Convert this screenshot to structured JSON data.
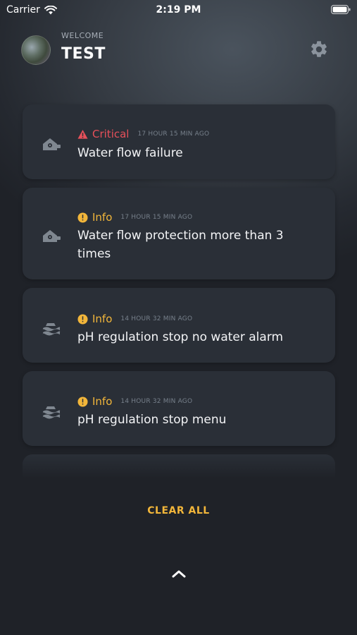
{
  "status_bar": {
    "carrier": "Carrier",
    "time": "2:19 PM"
  },
  "header": {
    "welcome": "WELCOME",
    "username": "TEST"
  },
  "notifications": [
    {
      "level": "Critical",
      "time": "17 HOUR 15 MIN AGO",
      "title": "Water flow failure",
      "icon": "house-pump-icon"
    },
    {
      "level": "Info",
      "time": "17 HOUR 15 MIN AGO",
      "title": "Water flow protection more than 3 times",
      "icon": "house-pump-icon"
    },
    {
      "level": "Info",
      "time": "14 HOUR 32 MIN AGO",
      "title": "pH regulation stop no water alarm",
      "icon": "ph-regulation-icon"
    },
    {
      "level": "Info",
      "time": "14 HOUR 32 MIN AGO",
      "title": "pH regulation stop menu",
      "icon": "ph-regulation-icon"
    }
  ],
  "actions": {
    "clear_all": "CLEAR ALL"
  },
  "colors": {
    "critical": "#e6505a",
    "info": "#f2b63a",
    "card": "#2a2f37"
  }
}
